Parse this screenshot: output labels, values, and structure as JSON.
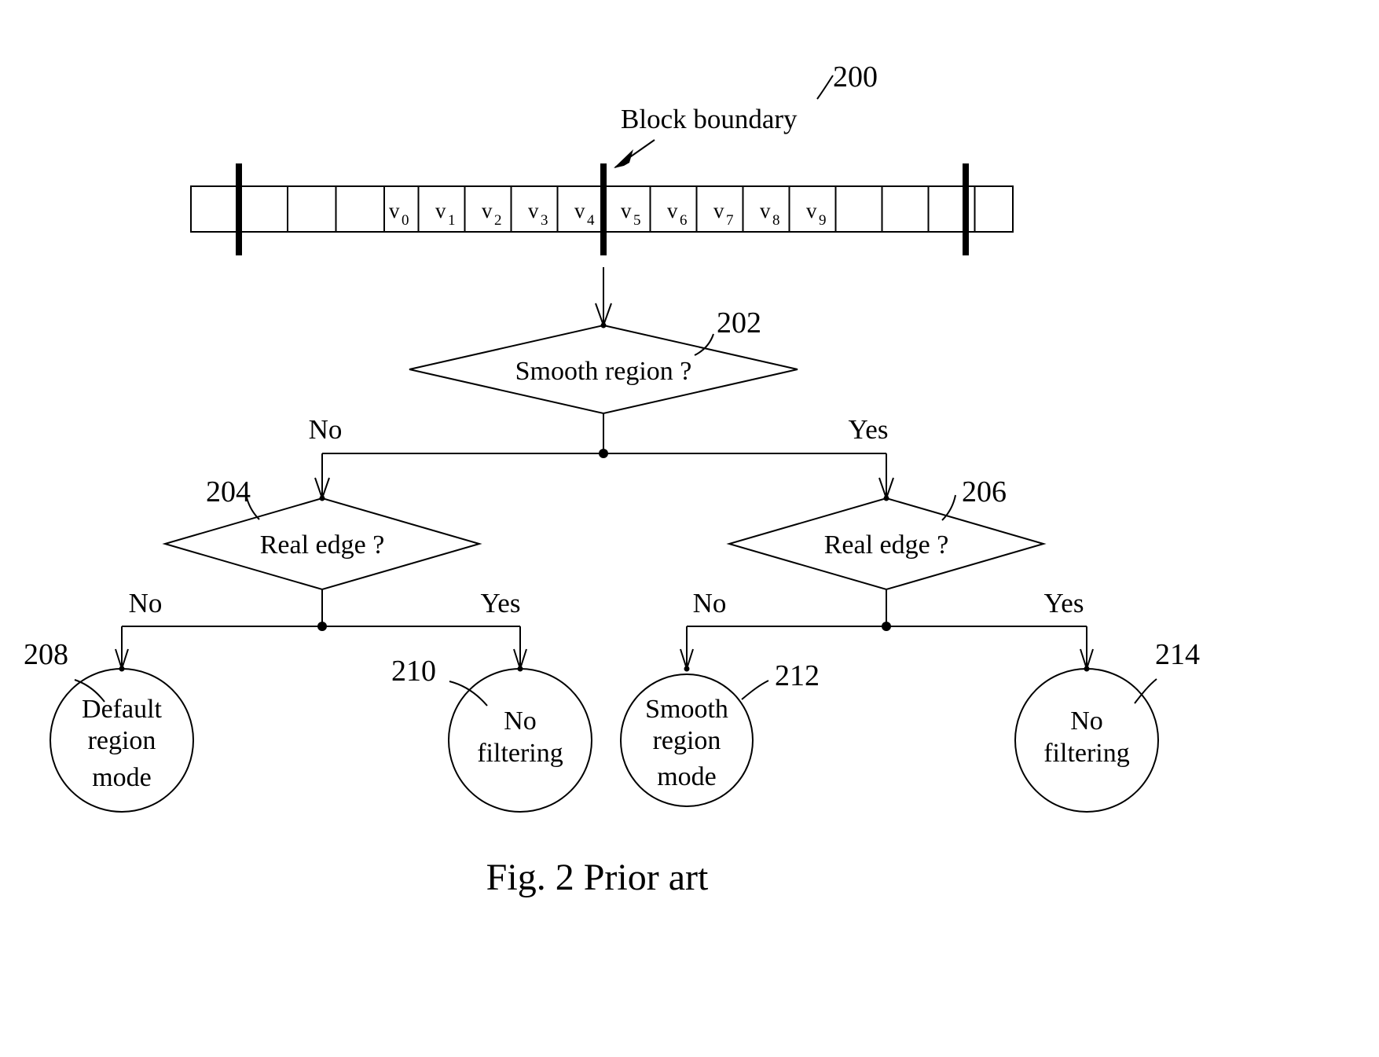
{
  "figure": {
    "caption": "Fig. 2 Prior art",
    "reference_200": "200",
    "boundary_label": "Block boundary"
  },
  "pixel_row": {
    "cells": [
      {
        "label": "",
        "sub": ""
      },
      {
        "label": "",
        "sub": ""
      },
      {
        "label": "",
        "sub": ""
      },
      {
        "label": "",
        "sub": ""
      },
      {
        "label": "v",
        "sub": "0"
      },
      {
        "label": "v",
        "sub": "1"
      },
      {
        "label": "v",
        "sub": "2"
      },
      {
        "label": "v",
        "sub": "3"
      },
      {
        "label": "v",
        "sub": "4"
      },
      {
        "label": "v",
        "sub": "5"
      },
      {
        "label": "v",
        "sub": "6"
      },
      {
        "label": "v",
        "sub": "7"
      },
      {
        "label": "v",
        "sub": "8"
      },
      {
        "label": "v",
        "sub": "9"
      },
      {
        "label": "",
        "sub": ""
      },
      {
        "label": "",
        "sub": ""
      },
      {
        "label": "",
        "sub": ""
      }
    ]
  },
  "decisions": {
    "root": {
      "text": "Smooth region ?",
      "ref": "202",
      "no": "No",
      "yes": "Yes"
    },
    "left": {
      "text": "Real edge ?",
      "ref": "204",
      "no": "No",
      "yes": "Yes"
    },
    "right": {
      "text": "Real edge ?",
      "ref": "206",
      "no": "No",
      "yes": "Yes"
    }
  },
  "outcomes": [
    {
      "ref": "208",
      "line1": "Default",
      "line2": "region",
      "line3": "mode"
    },
    {
      "ref": "210",
      "line1": "No",
      "line2": "filtering",
      "line3": ""
    },
    {
      "ref": "212",
      "line1": "Smooth",
      "line2": "region",
      "line3": "mode"
    },
    {
      "ref": "214",
      "line1": "No",
      "line2": "filtering",
      "line3": ""
    }
  ],
  "colors": {
    "ink": "#000000",
    "paper": "#ffffff"
  }
}
